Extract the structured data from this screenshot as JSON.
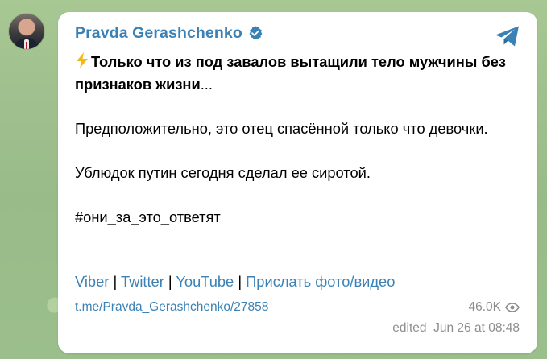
{
  "channel": {
    "name": "Pravda Gerashchenko",
    "verified_icon": "verified-badge-icon",
    "share_icon": "telegram-send-icon"
  },
  "post": {
    "emoji": "⚡",
    "bold_line": "Только что из под завалов вытащили тело мужчины без признаков жизни",
    "ellipsis": "...",
    "paragraphs": [
      "Предположительно, это отец спасённой только что девочки.",
      "Ублюдок путин сегодня сделал ее сиротой.",
      "#они_за_это_ответят"
    ],
    "links": {
      "viber": "Viber",
      "twitter": "Twitter",
      "youtube": "YouTube",
      "submit": "Прислать фото/видео",
      "separator": "|"
    },
    "post_link": "t.me/Pravda_Gerashchenko/27858",
    "views": "46.0K",
    "edited": "edited",
    "date_time": "Jun 26 at 08:48"
  },
  "colors": {
    "accent": "#3a81b5",
    "background": "#9fbf8f",
    "meta": "#8d8d8d"
  }
}
